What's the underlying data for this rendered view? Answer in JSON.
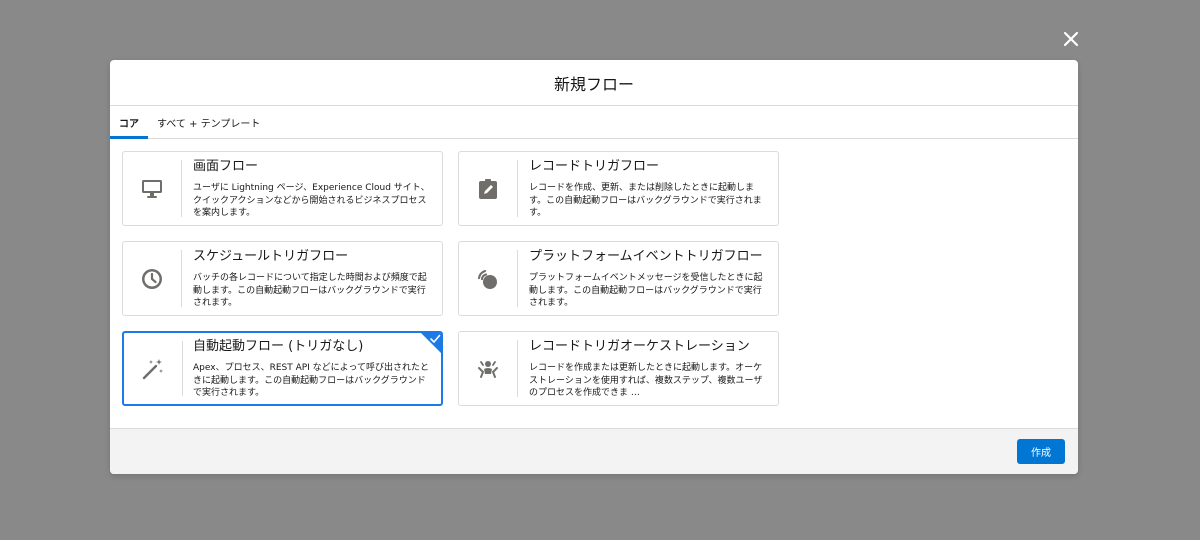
{
  "modal": {
    "title": "新規フロー",
    "close_icon": "close-icon"
  },
  "tabs": [
    {
      "label": "コア",
      "active": true
    },
    {
      "label": "すべて + テンプレート",
      "active": false
    }
  ],
  "cards": [
    {
      "title": "画面フロー",
      "description": "ユーザに Lightning ページ、Experience Cloud サイト、クイックアクションなどから開始されるビジネスプロセスを案内します。",
      "icon": "monitor-icon",
      "selected": false
    },
    {
      "title": "レコードトリガフロー",
      "description": "レコードを作成、更新、または削除したときに起動します。この自動起動フローはバックグラウンドで実行されます。",
      "icon": "clipboard-edit-icon",
      "selected": false
    },
    {
      "title": "スケジュールトリガフロー",
      "description": "バッチの各レコードについて指定した時間および頻度で起動します。この自動起動フローはバックグラウンドで実行されます。",
      "icon": "clock-icon",
      "selected": false
    },
    {
      "title": "プラットフォームイベントトリガフロー",
      "description": "プラットフォームイベントメッセージを受信したときに起動します。この自動起動フローはバックグラウンドで実行されます。",
      "icon": "broadcast-icon",
      "selected": false
    },
    {
      "title": "自動起動フロー (トリガなし)",
      "description": "Apex、プロセス、REST API などによって呼び出されたときに起動します。この自動起動フローはバックグラウンドで実行されます。",
      "icon": "magic-wand-icon",
      "selected": true
    },
    {
      "title": "レコードトリガオーケストレーション",
      "description": "レコードを作成または更新したときに起動します。オーケストレーションを使用すれば、複数ステップ、複数ユーザのプロセスを作成できま …",
      "icon": "orchestration-icon",
      "selected": false
    }
  ],
  "footer": {
    "create_label": "作成"
  },
  "colors": {
    "accent": "#0176d3",
    "selected_border": "#1b7ae5",
    "overlay": "#898989",
    "icon_gray": "#706e6b"
  }
}
